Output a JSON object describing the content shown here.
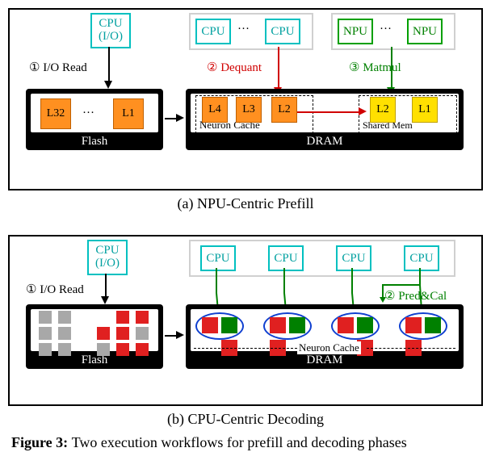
{
  "panelA": {
    "cpu_io_line1": "CPU",
    "cpu_io_line2": "(I/O)",
    "cpu_label": "CPU",
    "npu_label": "NPU",
    "dots": "···",
    "step1": "① I/O Read",
    "step2": "② Dequant",
    "step3": "③ Matmul",
    "flash_layers": [
      "L32",
      "L1"
    ],
    "flash_label": "Flash",
    "neuron_cache_layers": [
      "L4",
      "L3",
      "L2"
    ],
    "neuron_cache_label": "Neuron Cache",
    "shared_mem_layers": [
      "L2",
      "L1"
    ],
    "shared_mem_label": "Shared Mem",
    "dram_label": "DRAM",
    "caption": "(a) NPU-Centric Prefill"
  },
  "panelB": {
    "cpu_io_line1": "CPU",
    "cpu_io_line2": "(I/O)",
    "cpu_label": "CPU",
    "step1": "① I/O Read",
    "step2": "② Pred&Cal",
    "flash_label": "Flash",
    "neuron_cache_label": "Neuron Cache",
    "dram_label": "DRAM",
    "caption": "(b) CPU-Centric Decoding"
  },
  "figure_prefix": "Figure 3: ",
  "figure_rest": "Two execution workflows for prefill and decoding phases"
}
